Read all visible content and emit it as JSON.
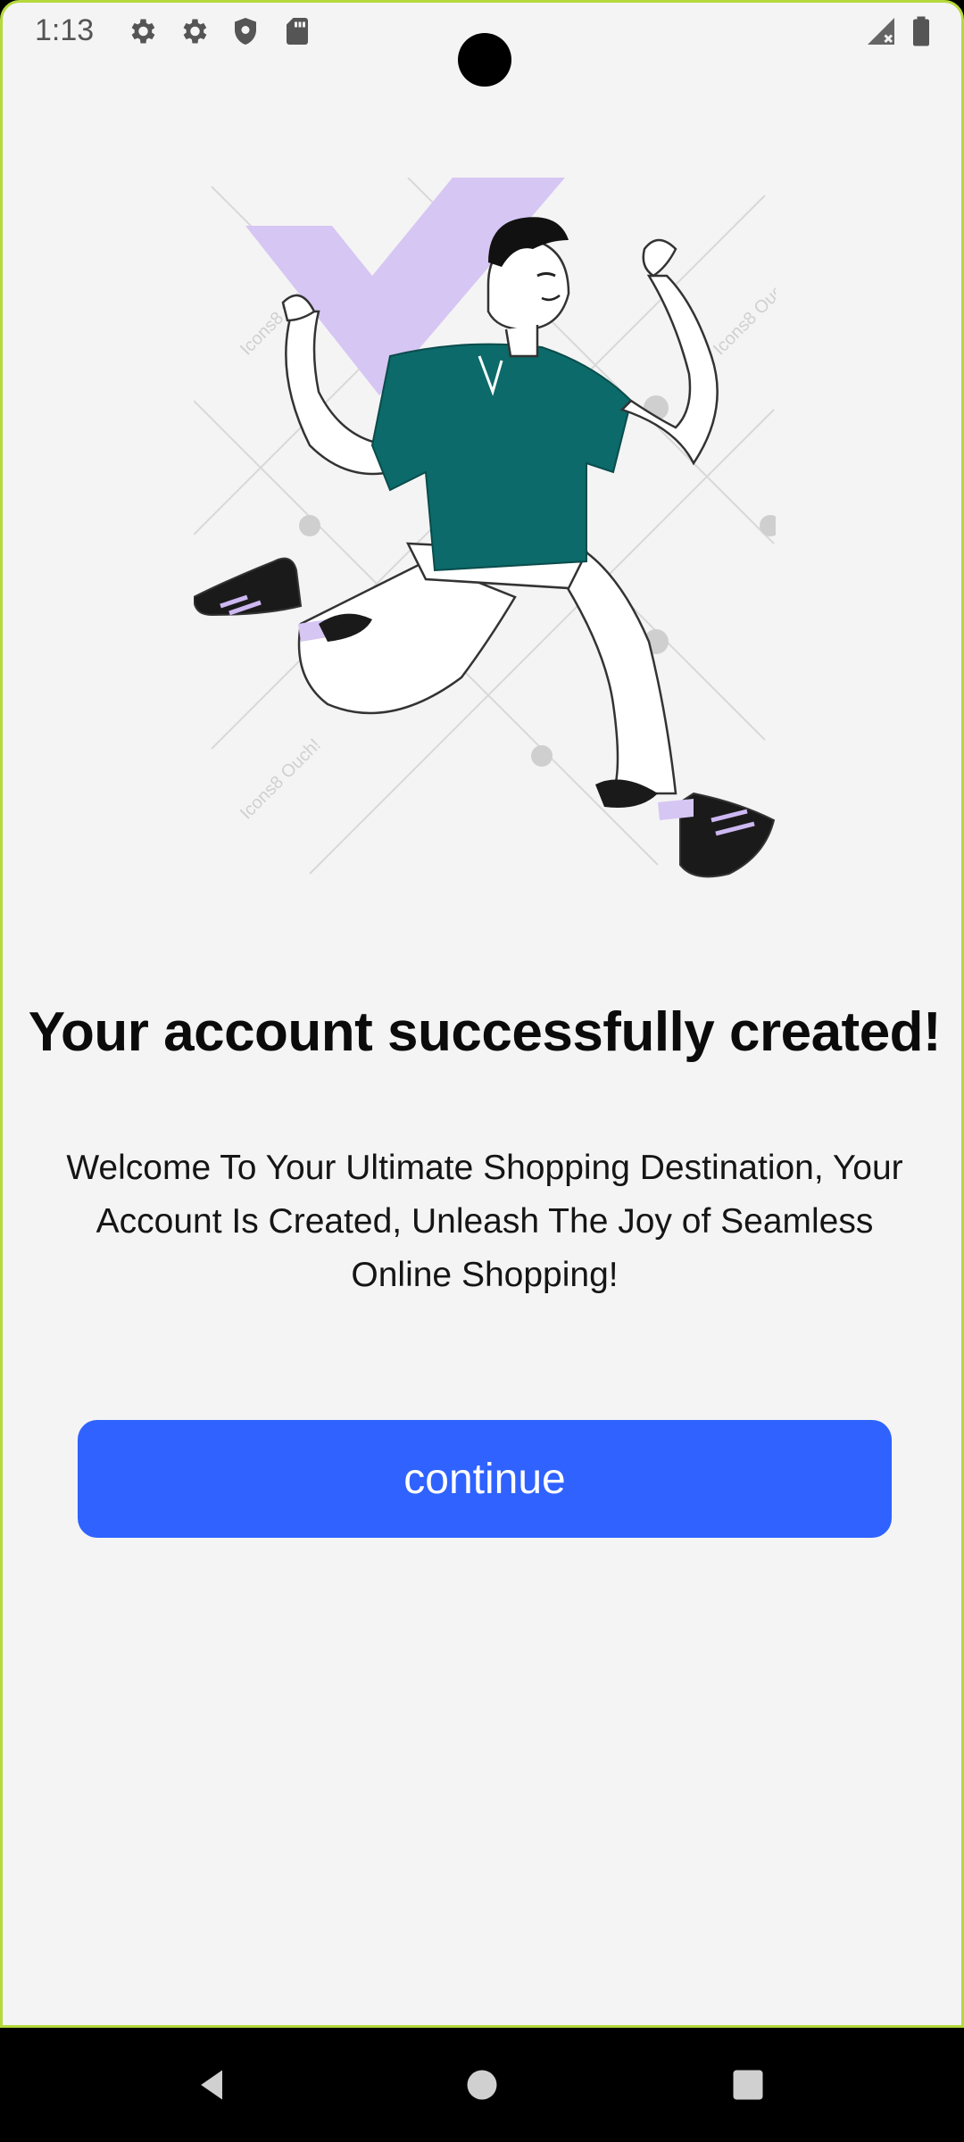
{
  "status_bar": {
    "time": "1:13",
    "left_icons": [
      "settings-icon",
      "settings-icon",
      "shield-icon",
      "sd-card-icon"
    ],
    "right_icons": [
      "signal-no-data-icon",
      "battery-icon"
    ]
  },
  "illustration": {
    "name": "running-man-checkmark-illustration",
    "watermark": "Icons8 Ouch!",
    "colors": {
      "checkmark": "#d6c6f3",
      "shirt": "#0c6a6a",
      "outline": "#222222"
    }
  },
  "content": {
    "headline": "Your account successfully created!",
    "message": "Welcome To Your Ultimate Shopping Destination, Your Account Is Created, Unleash The Joy of Seamless Online Shopping!",
    "continue_label": "continue"
  },
  "nav_bar": {
    "buttons": [
      "back-icon",
      "home-icon",
      "recents-icon"
    ]
  },
  "colors": {
    "accent": "#2f62ff",
    "background": "#f4f4f4",
    "frame": "#b5d83a"
  }
}
